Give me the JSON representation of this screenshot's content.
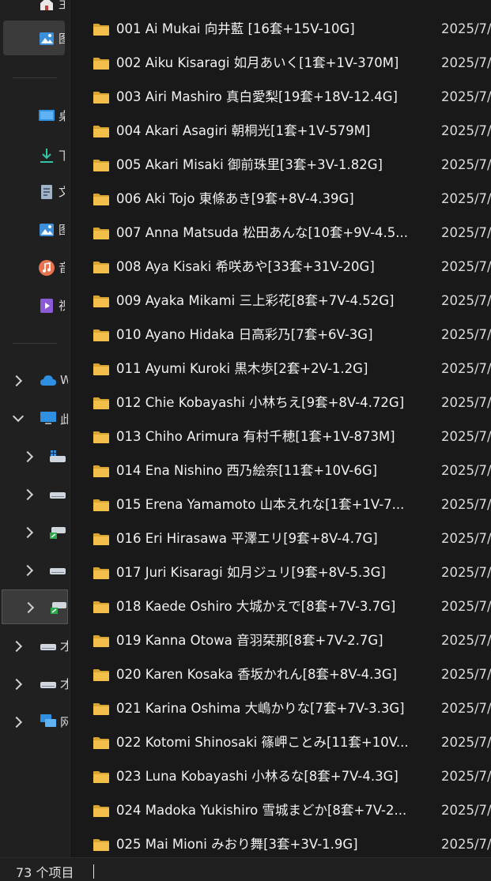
{
  "sidebar": {
    "quick_access": [
      {
        "icon": "home-icon",
        "label": "主"
      },
      {
        "icon": "gallery-icon",
        "label": "图"
      },
      {
        "icon": "desktop-icon",
        "label": "桌"
      },
      {
        "icon": "download-icon",
        "label": "下"
      },
      {
        "icon": "document-icon",
        "label": "文"
      },
      {
        "icon": "pictures-icon",
        "label": "图"
      },
      {
        "icon": "music-icon",
        "label": "音"
      },
      {
        "icon": "videos-icon",
        "label": "视"
      }
    ],
    "tree": [
      {
        "icon": "cloud-icon",
        "label": "W",
        "expanded": false
      },
      {
        "icon": "this-pc-icon",
        "label": "此",
        "expanded": true
      },
      {
        "icon": "drive-windows-icon",
        "label": "",
        "expanded": false
      },
      {
        "icon": "drive-icon",
        "label": "",
        "expanded": false
      },
      {
        "icon": "network-drive-icon",
        "label": "",
        "expanded": false
      },
      {
        "icon": "drive-icon",
        "label": "",
        "expanded": false
      },
      {
        "icon": "network-drive-icon",
        "label": "",
        "expanded": false,
        "selected": true
      },
      {
        "icon": "drive-icon",
        "label": "才",
        "expanded": false
      },
      {
        "icon": "drive-icon",
        "label": "才",
        "expanded": false
      },
      {
        "icon": "network-icon",
        "label": "网",
        "expanded": false
      }
    ]
  },
  "files": [
    {
      "name": "001 Ai Mukai 向井藍 [16套+15V-10G]",
      "date": "2025/7/"
    },
    {
      "name": "002 Aiku Kisaragi 如月あいく[1套+1V-370M]",
      "date": "2025/7/"
    },
    {
      "name": "003 Airi Mashiro 真白愛梨[19套+18V-12.4G]",
      "date": "2025/7/"
    },
    {
      "name": "004 Akari Asagiri 朝桐光[1套+1V-579M]",
      "date": "2025/7/"
    },
    {
      "name": "005 Akari Misaki 御前珠里[3套+3V-1.82G]",
      "date": "2025/7/"
    },
    {
      "name": "006 Aki Tojo 東條あき[9套+8V-4.39G]",
      "date": "2025/7/"
    },
    {
      "name": "007 Anna Matsuda 松田あんな[10套+9V-4.5...",
      "date": "2025/7/"
    },
    {
      "name": "008 Aya Kisaki 希咲あや[33套+31V-20G]",
      "date": "2025/7/"
    },
    {
      "name": "009 Ayaka Mikami 三上彩花[8套+7V-4.52G]",
      "date": "2025/7/"
    },
    {
      "name": "010 Ayano Hidaka 日高彩乃[7套+6V-3G]",
      "date": "2025/7/"
    },
    {
      "name": "011 Ayumi Kuroki 黒木歩[2套+2V-1.2G]",
      "date": "2025/7/"
    },
    {
      "name": "012 Chie Kobayashi 小林ちえ[9套+8V-4.72G]",
      "date": "2025/7/"
    },
    {
      "name": "013 Chiho Arimura 有村千穂[1套+1V-873M]",
      "date": "2025/7/"
    },
    {
      "name": "014 Ena Nishino 西乃絵奈[11套+10V-6G]",
      "date": "2025/7/"
    },
    {
      "name": "015 Erena Yamamoto 山本えれな[1套+1V-7...",
      "date": "2025/7/"
    },
    {
      "name": "016 Eri Hirasawa 平澤エリ[9套+8V-4.7G]",
      "date": "2025/7/"
    },
    {
      "name": "017 Juri Kisaragi 如月ジュリ[9套+8V-5.3G]",
      "date": "2025/7/"
    },
    {
      "name": "018 Kaede Oshiro 大城かえで[8套+7V-3.7G]",
      "date": "2025/7/"
    },
    {
      "name": "019 Kanna Otowa 音羽栞那[8套+7V-2.7G]",
      "date": "2025/7/"
    },
    {
      "name": "020 Karen Kosaka 香坂かれん[8套+8V-4.3G]",
      "date": "2025/7/"
    },
    {
      "name": "021 Karina Oshima 大嶋かりな[7套+7V-3.3G]",
      "date": "2025/7/"
    },
    {
      "name": "022 Kotomi Shinosaki 篠岬ことみ[11套+10V...",
      "date": "2025/7/"
    },
    {
      "name": "023 Luna Kobayashi 小林るな[8套+7V-4.3G]",
      "date": "2025/7/"
    },
    {
      "name": "024 Madoka Yukishiro 雪城まどか[8套+7V-2...",
      "date": "2025/7/"
    },
    {
      "name": "025 Mai Mioni みおり舞[3套+3V-1.9G]",
      "date": "2025/7/"
    }
  ],
  "status": {
    "item_count": "73 个项目"
  },
  "colors": {
    "folder": "#f2c04a",
    "folder_dark": "#d9a431",
    "selection": "#3b3b3b"
  }
}
